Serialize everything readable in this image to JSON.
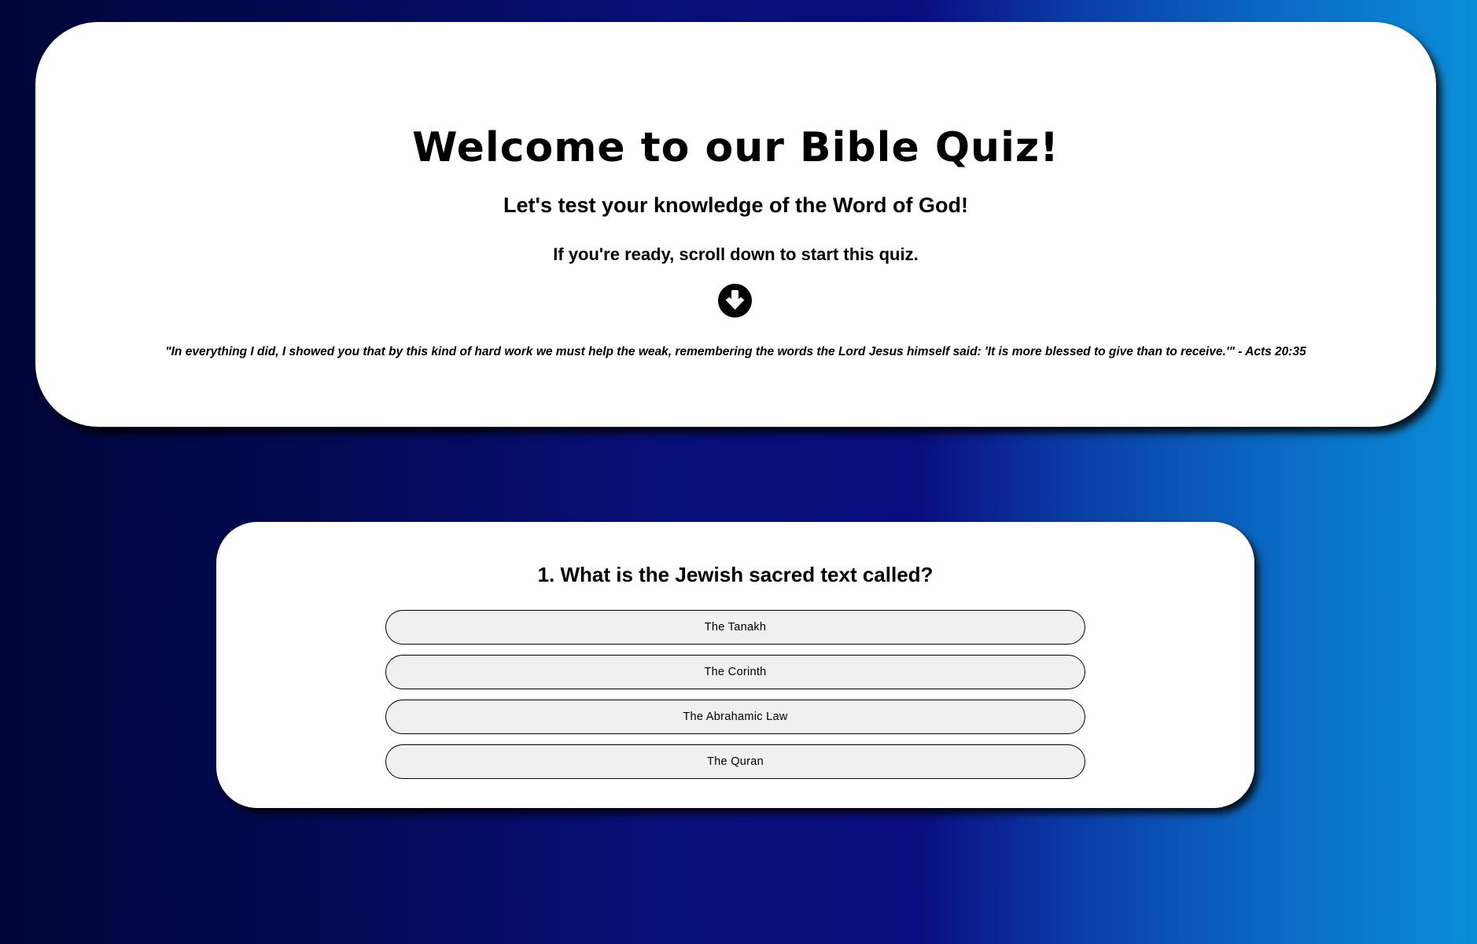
{
  "hero": {
    "title": "Welcome to our Bible Quiz!",
    "subtitle": "Let's test your knowledge of the Word of God!",
    "instruction": "If you're ready, scroll down to start this quiz.",
    "arrow_icon": "arrow-circle-down-icon",
    "quote": "\"In everything I did, I showed you that by this kind of hard work we must help the weak, remembering the words the Lord Jesus himself said: 'It is more blessed to give than to receive.'\" - Acts 20:35"
  },
  "quiz": {
    "question": "1. What is the Jewish sacred text called?",
    "answers": [
      {
        "label": "The Tanakh"
      },
      {
        "label": "The Corinth"
      },
      {
        "label": "The Abrahamic Law"
      },
      {
        "label": "The Quran"
      }
    ]
  },
  "colors": {
    "background_left": "#020538",
    "background_mid": "#090c7e",
    "background_right": "#0b8ed8",
    "card": "#ffffff",
    "button": "#f0f0f0"
  }
}
